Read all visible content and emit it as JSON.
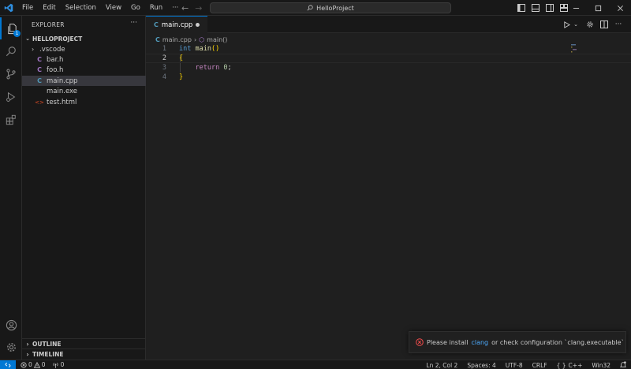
{
  "titlebar": {
    "menu": [
      "File",
      "Edit",
      "Selection",
      "View",
      "Go",
      "Run",
      "···"
    ],
    "search_text": "HelloProject"
  },
  "activity": {
    "explorer_badge": "1"
  },
  "sidebar": {
    "title": "EXPLORER",
    "more": "···",
    "folder": "HELLOPROJECT",
    "items": [
      {
        "label": ".vscode",
        "type": "folder"
      },
      {
        "label": "bar.h",
        "type": "c-header"
      },
      {
        "label": "foo.h",
        "type": "c-header"
      },
      {
        "label": "main.cpp",
        "type": "cpp",
        "selected": true
      },
      {
        "label": "main.exe",
        "type": "exe"
      },
      {
        "label": "test.html",
        "type": "html"
      }
    ],
    "outline": "OUTLINE",
    "timeline": "TIMELINE"
  },
  "editor": {
    "tab_label": "main.cpp",
    "breadcrumb_file": "main.cpp",
    "breadcrumb_symbol": "main()",
    "lines": [
      {
        "n": "1",
        "k": "int",
        "f": "main",
        "p": "()"
      },
      {
        "n": "2",
        "b": "{"
      },
      {
        "n": "3",
        "c": "return",
        "num": "0",
        "p": ";"
      },
      {
        "n": "4",
        "b": "}"
      }
    ]
  },
  "notification": {
    "pre": "Please install",
    "link": "clang",
    "post": "or check configuration `clang.executable`"
  },
  "statusbar": {
    "errors": "0",
    "warnings": "0",
    "ports": "0",
    "position": "Ln 2, Col 2",
    "spaces": "Spaces: 4",
    "encoding": "UTF-8",
    "eol": "CRLF",
    "language": "C++",
    "platform": "Win32"
  },
  "colors": {
    "accent": "#0078d4",
    "background": "#1f1f1f",
    "sidebar": "#181818",
    "error": "#f14c4c"
  }
}
